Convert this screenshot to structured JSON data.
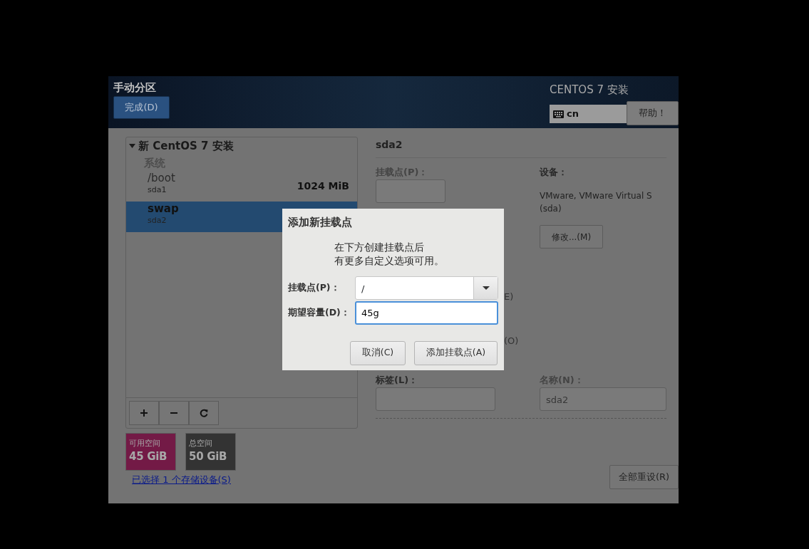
{
  "header": {
    "title": "手动分区",
    "done_button": "完成(D)",
    "product": "CENTOS 7 安装",
    "keyboard_layout": "cn",
    "help_button": "帮助！"
  },
  "tree": {
    "label": "新 CentOS 7 安装",
    "expanded": true,
    "children": [
      {
        "label": "系统",
        "children": [
          {
            "name": "/boot",
            "device": "sda1",
            "size": "1024 MiB",
            "selected": false
          },
          {
            "name": "swap",
            "device": "sda2",
            "selected": true
          }
        ]
      }
    ]
  },
  "space": [
    {
      "label": "可用空间",
      "value": "45 GiB",
      "color": "#731a46"
    },
    {
      "label": "总空间",
      "value": "50 GiB",
      "color": "#333333"
    }
  ],
  "storage_link": "已选择 1 个存储设备(S)",
  "details": {
    "title": "sda2",
    "mount_point_label": "挂载点(P)：",
    "device_label": "设备：",
    "device_lines": [
      "VMware, VMware Virtual S",
      "(sda)"
    ],
    "modify_button": "修改...(M)",
    "partial_texts": [
      "E)",
      "(O)"
    ],
    "label_label": "标签(L)：",
    "name_label": "名称(N)：",
    "name_field": {
      "value": "sda2",
      "disabled": true
    }
  },
  "reset_button": "全部重设(R)",
  "dialog": {
    "title": "添加新挂载点",
    "message_lines": [
      "在下方创建挂载点后",
      "有更多自定义选项可用。"
    ],
    "mount_label": "挂载点(P)：",
    "mount_value": "/",
    "capacity_label": "期望容量(D)：",
    "capacity_value": "45g",
    "cancel_button": "取消(C)",
    "add_button": "添加挂载点(A)"
  }
}
